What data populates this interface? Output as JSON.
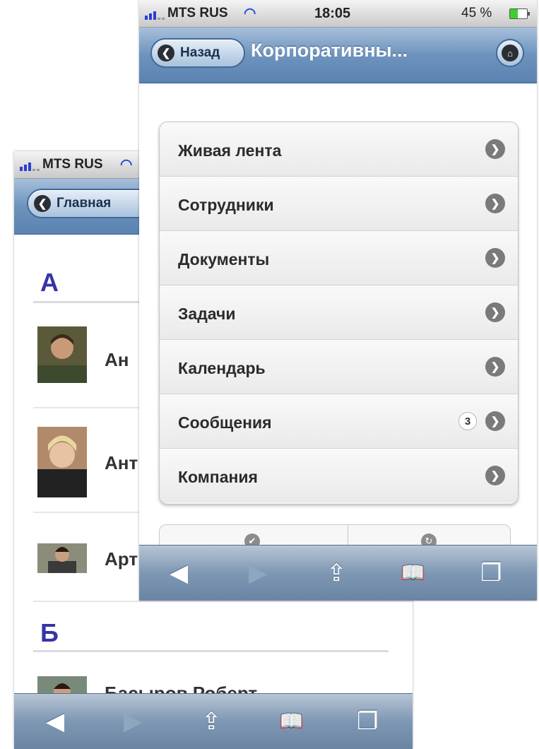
{
  "back_screen": {
    "status": {
      "carrier": "MTS RUS"
    },
    "nav": {
      "back_label": "Главная"
    },
    "sections": [
      {
        "letter": "А",
        "people": [
          "Ан",
          "Ант",
          "Арт"
        ]
      },
      {
        "letter": "Б",
        "people": [
          "Басыров Роберт"
        ]
      }
    ]
  },
  "front_screen": {
    "status": {
      "carrier": "MTS RUS",
      "time": "18:05",
      "battery": "45 %"
    },
    "nav": {
      "back_label": "Назад",
      "title": "Корпоративны..."
    },
    "menu": [
      {
        "label": "Живая лента"
      },
      {
        "label": "Сотрудники"
      },
      {
        "label": "Документы"
      },
      {
        "label": "Задачи"
      },
      {
        "label": "Календарь"
      },
      {
        "label": "Сообщения",
        "badge": "3"
      },
      {
        "label": "Компания"
      }
    ]
  },
  "icons": {
    "back": "◀",
    "forward": "▶",
    "share": "⇪",
    "bookmarks": "📖",
    "tabs": "❐",
    "home": "⌂",
    "chevron": "❯",
    "check": "✔",
    "refresh": "↻"
  },
  "colors": {
    "navbar": "#6d93bd",
    "section_letter": "#3734a7",
    "signal": "#2d3ed1",
    "battery": "#3fcf2f"
  }
}
